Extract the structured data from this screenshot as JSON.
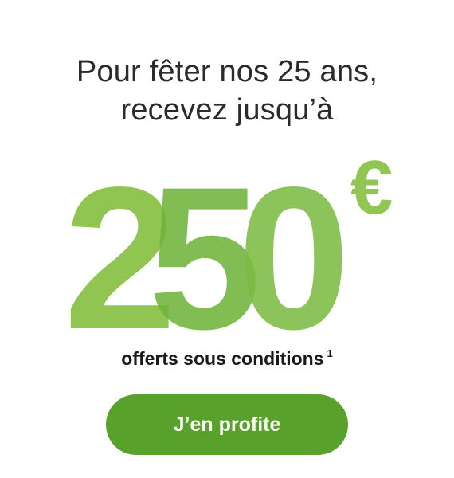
{
  "promo": {
    "headline_line1": "Pour fêter nos 25 ans,",
    "headline_line2": "recevez jusqu’à",
    "amount": {
      "digit_1": "2",
      "digit_2": "5",
      "digit_3": "0",
      "currency": "€",
      "value": 250
    },
    "subtitle": "offerts sous conditions",
    "footnote_marker": "1",
    "cta_label": "J’en profite"
  },
  "colors": {
    "text_dark": "#2b2b2b",
    "green_light": "#8bc34a",
    "green_mid": "#6bb033",
    "green_button": "#58a12a",
    "button_text": "#ffffff"
  }
}
